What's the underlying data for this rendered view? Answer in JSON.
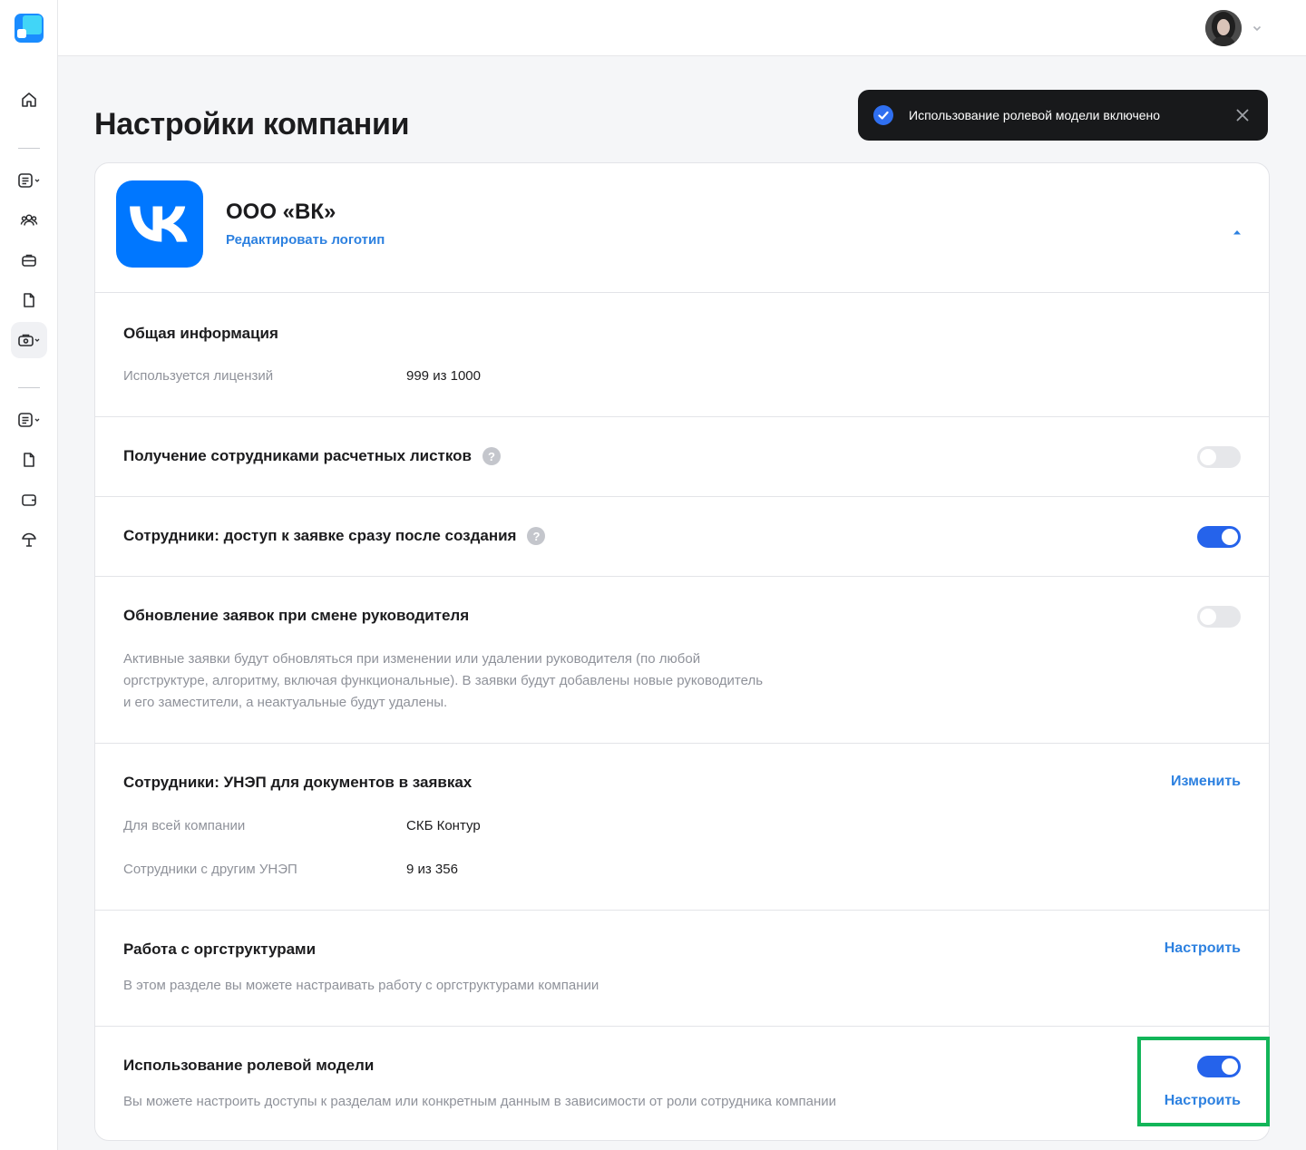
{
  "app": {
    "accent_color": "#2d81e0",
    "toggle_on_color": "#2563eb",
    "highlight_color": "#12b559"
  },
  "sidebar": {
    "logo_icon": "app-logo-icon",
    "items": [
      {
        "icon": "home-icon",
        "active": false
      },
      {
        "icon": "document-list-icon",
        "dropdown": true,
        "active": false
      },
      {
        "icon": "users-icon",
        "active": false
      },
      {
        "icon": "briefcase-icon",
        "active": false
      },
      {
        "icon": "file-icon",
        "active": false
      },
      {
        "icon": "company-settings-icon",
        "dropdown": true,
        "active": true
      },
      {
        "icon": "document-list-icon",
        "dropdown": true,
        "active": false
      },
      {
        "icon": "file-icon",
        "active": false
      },
      {
        "icon": "wallet-icon",
        "active": false
      },
      {
        "icon": "beach-umbrella-icon",
        "active": false
      }
    ]
  },
  "header": {
    "avatar_icon": "user-avatar",
    "menu_icon": "chevron-down-icon"
  },
  "page": {
    "title": "Настройки компании"
  },
  "toast": {
    "text": "Использование ролевой модели включено",
    "icon": "check-circle-icon",
    "close_icon": "close-icon"
  },
  "company": {
    "name": "ООО «ВК»",
    "edit_logo_label": "Редактировать логотип",
    "logo_icon": "vk-logo-icon"
  },
  "general_info": {
    "title": "Общая информация",
    "licenses_label": "Используется лицензий",
    "licenses_value": "999 из 1000"
  },
  "payslips": {
    "title": "Получение сотрудниками расчетных листков",
    "help": "?",
    "enabled": false
  },
  "request_access": {
    "title": "Сотрудники: доступ к заявке сразу после создания",
    "help": "?",
    "enabled": true
  },
  "manager_update": {
    "title": "Обновление заявок при смене руководителя",
    "enabled": false,
    "desc_line1": "Активные заявки будут обновляться при изменении или удалении руководителя (по любой",
    "desc_line2": "оргструктуре, алгоритму, включая функциональные). В заявки будут добавлены новые руководитель",
    "desc_line3": "и его заместители, а неактуальные будут удалены."
  },
  "unep": {
    "title": "Сотрудники: УНЭП для документов в заявках",
    "change_label": "Изменить",
    "company_label": "Для всей компании",
    "company_value": "СКБ Контур",
    "other_label": "Сотрудники с другим УНЭП",
    "other_value": "9 из 356"
  },
  "org": {
    "title": "Работа с оргструктурами",
    "configure_label": "Настроить",
    "desc": "В этом разделе вы можете настраивать работу с оргструктурами компании"
  },
  "roles": {
    "title": "Использование ролевой модели",
    "enabled": true,
    "configure_label": "Настроить",
    "desc": "Вы можете настроить доступы к разделам или конкретным данным в зависимости от роли сотрудника компании"
  }
}
